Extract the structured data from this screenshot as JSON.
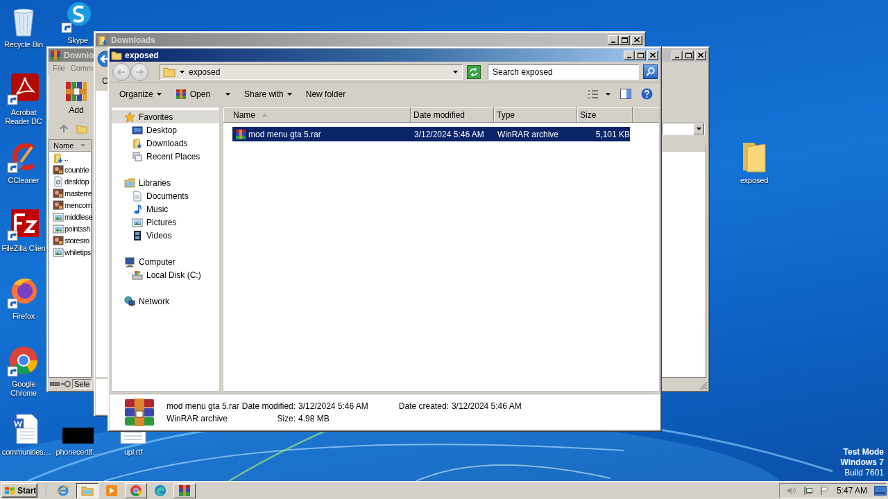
{
  "desktop_icons": [
    {
      "label": "Recycle Bin",
      "kind": "recycle-bin",
      "shortcut": false
    },
    {
      "label": "Skype",
      "kind": "skype",
      "shortcut": true
    },
    {
      "label": "Acrobat Reader DC",
      "kind": "acrobat",
      "shortcut": true
    },
    {
      "label": "CCleaner",
      "kind": "ccleaner",
      "shortcut": true
    },
    {
      "label": "FileZilla Clien",
      "kind": "filezilla",
      "shortcut": true
    },
    {
      "label": "Firefox",
      "kind": "firefox",
      "shortcut": true
    },
    {
      "label": "Google Chrome",
      "kind": "chrome",
      "shortcut": true
    },
    {
      "label": "communities…",
      "kind": "word-doc",
      "shortcut": false
    },
    {
      "label": "phonecertif…",
      "kind": "black-thumbnail",
      "shortcut": false
    },
    {
      "label": "upl.rtf",
      "kind": "rtf-doc",
      "shortcut": false
    },
    {
      "label": "exposed",
      "kind": "folder",
      "shortcut": false
    }
  ],
  "winrar_window": {
    "title": "Downlo",
    "active": false,
    "menu": [
      "File",
      "Comm"
    ],
    "toolbar_button": "Add",
    "list_header": "Name",
    "files": [
      {
        "name": "..",
        "kind": "parent"
      },
      {
        "name": "countrie",
        "kind": "photo"
      },
      {
        "name": "desktop",
        "kind": "settings"
      },
      {
        "name": "masterre",
        "kind": "photo"
      },
      {
        "name": "mencom",
        "kind": "photo"
      },
      {
        "name": "middlese",
        "kind": "bitmap"
      },
      {
        "name": "pointssh",
        "kind": "bitmap"
      },
      {
        "name": "storesro",
        "kind": "photo"
      },
      {
        "name": "whiletips",
        "kind": "bitmap"
      }
    ],
    "status": "Sele"
  },
  "downloads_window": {
    "title": "Downloads",
    "active": false,
    "toolbar_fragment": "C"
  },
  "explorer_window": {
    "title": "exposed",
    "active": true,
    "address": "exposed",
    "search": {
      "placeholder": "Search exposed"
    },
    "toolbar": [
      {
        "label": "Organize",
        "kind": "menu"
      },
      {
        "label": "Open",
        "kind": "app-menu"
      },
      {
        "label": "Share with",
        "kind": "menu"
      },
      {
        "label": "New folder",
        "kind": "command"
      }
    ],
    "nav_tree": [
      {
        "label": "Favorites",
        "kind": "favorites",
        "selected": true,
        "children": [
          {
            "label": "Desktop",
            "kind": "desktop",
            "selected": false
          },
          {
            "label": "Downloads",
            "kind": "downloads",
            "selected": false
          },
          {
            "label": "Recent Places",
            "kind": "recent",
            "selected": false
          }
        ]
      },
      {
        "label": "Libraries",
        "kind": "libraries",
        "selected": false,
        "children": [
          {
            "label": "Documents",
            "kind": "documents",
            "selected": false
          },
          {
            "label": "Music",
            "kind": "music",
            "selected": false
          },
          {
            "label": "Pictures",
            "kind": "pictures",
            "selected": false
          },
          {
            "label": "Videos",
            "kind": "videos",
            "selected": false
          }
        ]
      },
      {
        "label": "Computer",
        "kind": "computer",
        "selected": false,
        "children": [
          {
            "label": "Local Disk (C:)",
            "kind": "disk",
            "selected": false
          }
        ]
      },
      {
        "label": "Network",
        "kind": "network",
        "selected": false
      }
    ],
    "columns": [
      {
        "label": "Name",
        "sorted": true
      },
      {
        "label": "Date modified",
        "sorted": false
      },
      {
        "label": "Type",
        "sorted": false
      },
      {
        "label": "Size",
        "sorted": false
      }
    ],
    "rows": [
      {
        "name": "mod menu gta 5.rar",
        "date_modified": "3/12/2024 5:46 AM",
        "type": "WinRAR archive",
        "size": "5,101 KB",
        "selected": true
      }
    ],
    "details": {
      "name": "mod menu gta 5.rar",
      "type": "WinRAR archive",
      "fields": [
        {
          "label": "Date modified:",
          "value": "3/12/2024 5:46 AM"
        },
        {
          "label": "Size:",
          "value": "4.98 MB"
        },
        {
          "label": "Date created:",
          "value": "3/12/2024 5:46 AM"
        }
      ]
    }
  },
  "taskbar": {
    "start": "Start",
    "apps": [
      {
        "kind": "ie",
        "open": false,
        "active": false
      },
      {
        "kind": "explorer",
        "open": true,
        "active": true
      },
      {
        "kind": "media",
        "open": false,
        "active": false
      },
      {
        "kind": "chrome",
        "open": true,
        "active": false
      },
      {
        "kind": "edge",
        "open": false,
        "active": false
      },
      {
        "kind": "winrar",
        "open": true,
        "active": false
      }
    ],
    "clock": "5:47 AM"
  },
  "desktop_notice": [
    {
      "text": "Test Mode",
      "bold": true
    },
    {
      "text": "Windows 7",
      "bold": true
    },
    {
      "text": "Build 7601",
      "bold": false
    }
  ]
}
